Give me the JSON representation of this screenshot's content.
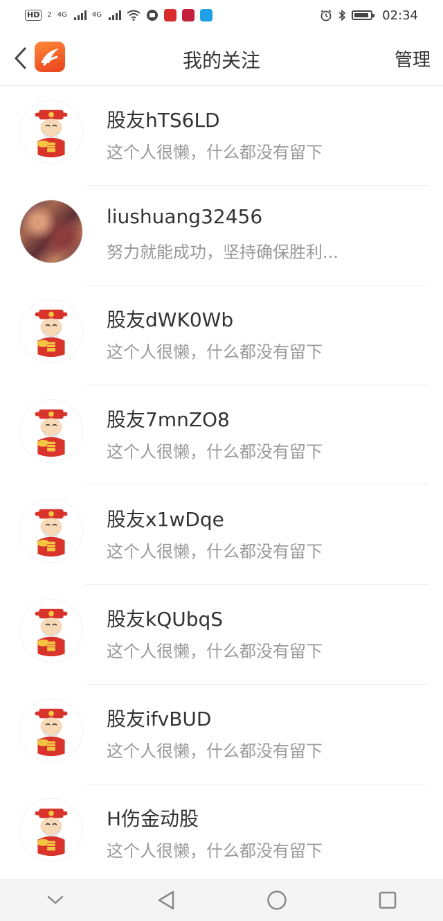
{
  "status_bar": {
    "hd": "HD",
    "sim": "2",
    "network1": "4G",
    "network2": "4G",
    "time": "02:34",
    "icons": [
      "wifi-icon",
      "alarm-icon",
      "bluetooth-icon",
      "battery-icon"
    ]
  },
  "header": {
    "title": "我的关注",
    "manage_label": "管理",
    "back_icon": "chevron-left-icon",
    "logo_icon": "app-logo-icon",
    "accent": "#f26522"
  },
  "follows": [
    {
      "name": "股友hTS6LD",
      "bio": "这个人很懒，什么都没有留下",
      "avatar": "cartoon"
    },
    {
      "name": "liushuang32456",
      "bio": "努力就能成功，坚持确保胜利...",
      "avatar": "photo"
    },
    {
      "name": "股友dWK0Wb",
      "bio": "这个人很懒，什么都没有留下",
      "avatar": "cartoon"
    },
    {
      "name": "股友7mnZO8",
      "bio": "这个人很懒，什么都没有留下",
      "avatar": "cartoon"
    },
    {
      "name": "股友x1wDqe",
      "bio": "这个人很懒，什么都没有留下",
      "avatar": "cartoon"
    },
    {
      "name": "股友kQUbqS",
      "bio": "这个人很懒，什么都没有留下",
      "avatar": "cartoon"
    },
    {
      "name": "股友ifvBUD",
      "bio": "这个人很懒，什么都没有留下",
      "avatar": "cartoon"
    },
    {
      "name": "H伤金动股",
      "bio": "这个人很懒，什么都没有留下",
      "avatar": "cartoon"
    }
  ],
  "nav": {
    "icons": [
      "chevron-down-icon",
      "back-triangle-icon",
      "home-circle-icon",
      "recents-square-icon"
    ]
  }
}
